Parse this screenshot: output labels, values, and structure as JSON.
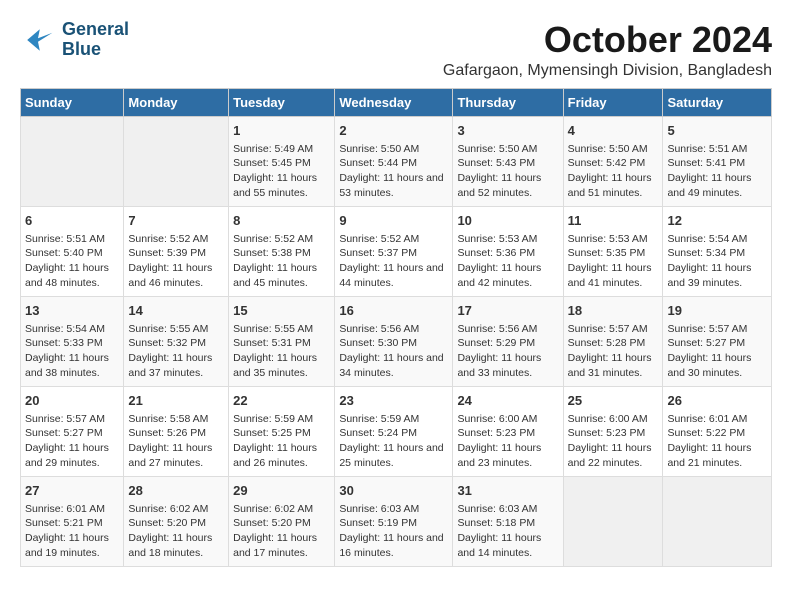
{
  "logo": {
    "line1": "General",
    "line2": "Blue"
  },
  "title": "October 2024",
  "subtitle": "Gafargaon, Mymensingh Division, Bangladesh",
  "weekdays": [
    "Sunday",
    "Monday",
    "Tuesday",
    "Wednesday",
    "Thursday",
    "Friday",
    "Saturday"
  ],
  "weeks": [
    [
      {
        "day": "",
        "info": ""
      },
      {
        "day": "",
        "info": ""
      },
      {
        "day": "1",
        "info": "Sunrise: 5:49 AM\nSunset: 5:45 PM\nDaylight: 11 hours and 55 minutes."
      },
      {
        "day": "2",
        "info": "Sunrise: 5:50 AM\nSunset: 5:44 PM\nDaylight: 11 hours and 53 minutes."
      },
      {
        "day": "3",
        "info": "Sunrise: 5:50 AM\nSunset: 5:43 PM\nDaylight: 11 hours and 52 minutes."
      },
      {
        "day": "4",
        "info": "Sunrise: 5:50 AM\nSunset: 5:42 PM\nDaylight: 11 hours and 51 minutes."
      },
      {
        "day": "5",
        "info": "Sunrise: 5:51 AM\nSunset: 5:41 PM\nDaylight: 11 hours and 49 minutes."
      }
    ],
    [
      {
        "day": "6",
        "info": "Sunrise: 5:51 AM\nSunset: 5:40 PM\nDaylight: 11 hours and 48 minutes."
      },
      {
        "day": "7",
        "info": "Sunrise: 5:52 AM\nSunset: 5:39 PM\nDaylight: 11 hours and 46 minutes."
      },
      {
        "day": "8",
        "info": "Sunrise: 5:52 AM\nSunset: 5:38 PM\nDaylight: 11 hours and 45 minutes."
      },
      {
        "day": "9",
        "info": "Sunrise: 5:52 AM\nSunset: 5:37 PM\nDaylight: 11 hours and 44 minutes."
      },
      {
        "day": "10",
        "info": "Sunrise: 5:53 AM\nSunset: 5:36 PM\nDaylight: 11 hours and 42 minutes."
      },
      {
        "day": "11",
        "info": "Sunrise: 5:53 AM\nSunset: 5:35 PM\nDaylight: 11 hours and 41 minutes."
      },
      {
        "day": "12",
        "info": "Sunrise: 5:54 AM\nSunset: 5:34 PM\nDaylight: 11 hours and 39 minutes."
      }
    ],
    [
      {
        "day": "13",
        "info": "Sunrise: 5:54 AM\nSunset: 5:33 PM\nDaylight: 11 hours and 38 minutes."
      },
      {
        "day": "14",
        "info": "Sunrise: 5:55 AM\nSunset: 5:32 PM\nDaylight: 11 hours and 37 minutes."
      },
      {
        "day": "15",
        "info": "Sunrise: 5:55 AM\nSunset: 5:31 PM\nDaylight: 11 hours and 35 minutes."
      },
      {
        "day": "16",
        "info": "Sunrise: 5:56 AM\nSunset: 5:30 PM\nDaylight: 11 hours and 34 minutes."
      },
      {
        "day": "17",
        "info": "Sunrise: 5:56 AM\nSunset: 5:29 PM\nDaylight: 11 hours and 33 minutes."
      },
      {
        "day": "18",
        "info": "Sunrise: 5:57 AM\nSunset: 5:28 PM\nDaylight: 11 hours and 31 minutes."
      },
      {
        "day": "19",
        "info": "Sunrise: 5:57 AM\nSunset: 5:27 PM\nDaylight: 11 hours and 30 minutes."
      }
    ],
    [
      {
        "day": "20",
        "info": "Sunrise: 5:57 AM\nSunset: 5:27 PM\nDaylight: 11 hours and 29 minutes."
      },
      {
        "day": "21",
        "info": "Sunrise: 5:58 AM\nSunset: 5:26 PM\nDaylight: 11 hours and 27 minutes."
      },
      {
        "day": "22",
        "info": "Sunrise: 5:59 AM\nSunset: 5:25 PM\nDaylight: 11 hours and 26 minutes."
      },
      {
        "day": "23",
        "info": "Sunrise: 5:59 AM\nSunset: 5:24 PM\nDaylight: 11 hours and 25 minutes."
      },
      {
        "day": "24",
        "info": "Sunrise: 6:00 AM\nSunset: 5:23 PM\nDaylight: 11 hours and 23 minutes."
      },
      {
        "day": "25",
        "info": "Sunrise: 6:00 AM\nSunset: 5:23 PM\nDaylight: 11 hours and 22 minutes."
      },
      {
        "day": "26",
        "info": "Sunrise: 6:01 AM\nSunset: 5:22 PM\nDaylight: 11 hours and 21 minutes."
      }
    ],
    [
      {
        "day": "27",
        "info": "Sunrise: 6:01 AM\nSunset: 5:21 PM\nDaylight: 11 hours and 19 minutes."
      },
      {
        "day": "28",
        "info": "Sunrise: 6:02 AM\nSunset: 5:20 PM\nDaylight: 11 hours and 18 minutes."
      },
      {
        "day": "29",
        "info": "Sunrise: 6:02 AM\nSunset: 5:20 PM\nDaylight: 11 hours and 17 minutes."
      },
      {
        "day": "30",
        "info": "Sunrise: 6:03 AM\nSunset: 5:19 PM\nDaylight: 11 hours and 16 minutes."
      },
      {
        "day": "31",
        "info": "Sunrise: 6:03 AM\nSunset: 5:18 PM\nDaylight: 11 hours and 14 minutes."
      },
      {
        "day": "",
        "info": ""
      },
      {
        "day": "",
        "info": ""
      }
    ]
  ]
}
